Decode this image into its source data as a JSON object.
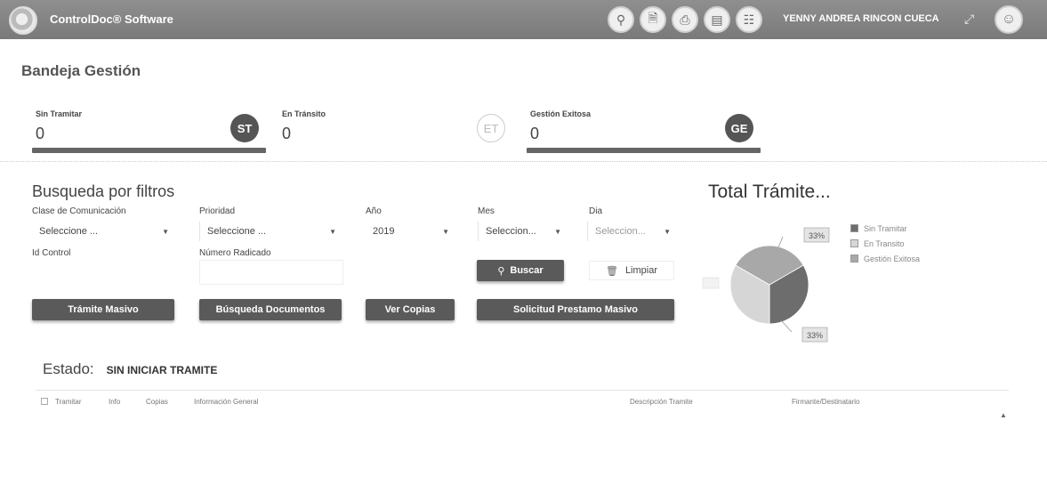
{
  "header": {
    "app_title": "ControlDoc® Software",
    "user_name": "YENNY ANDREA RINCON CUECA",
    "icons": [
      "search-icon",
      "document-icon",
      "print-icon",
      "file-icon",
      "report-icon"
    ]
  },
  "page_title": "Bandeja Gestión",
  "status_cards": [
    {
      "label": "Sin Tramitar",
      "value": "0",
      "badge": "ST"
    },
    {
      "label": "En Tránsito",
      "value": "0",
      "badge": "ET"
    },
    {
      "label": "Gestión Exitosa",
      "value": "0",
      "badge": "GE"
    }
  ],
  "filters": {
    "title": "Busqueda por filtros",
    "clase_label": "Clase de Comunicación",
    "clase_value": "Seleccione ...",
    "prioridad_label": "Prioridad",
    "prioridad_value": "Seleccione ...",
    "anio_label": "Año",
    "anio_value": "2019",
    "mes_label": "Mes",
    "mes_value": "Seleccion...",
    "dia_label": "Dia",
    "dia_value": "Seleccion...",
    "id_control_label": "Id Control",
    "numero_radicado_label": "Número Radicado",
    "buscar_label": "Buscar",
    "limpiar_label": "Limpiar"
  },
  "actions": {
    "tramite_masivo": "Trámite Masivo",
    "busqueda_documentos": "Búsqueda Documentos",
    "ver_copias": "Ver Copias",
    "solicitud_prestamo": "Solicitud Prestamo Masivo"
  },
  "chart_data": {
    "type": "pie",
    "title": "Total Trámite...",
    "categories": [
      "Sin Tramitar",
      "En Transito",
      "Gestión Exitosa"
    ],
    "values": [
      33,
      33,
      33
    ],
    "data_labels": [
      "33%",
      "33%"
    ],
    "colors": [
      "#6d6d6d",
      "#d6d6d6",
      "#a8a8a8"
    ],
    "legend_position": "right"
  },
  "estado": {
    "label": "Estado:",
    "value": "SIN INICIAR TRAMITE"
  },
  "table": {
    "columns": [
      "Tramitar",
      "Info",
      "Copias",
      "Información General",
      "Descripción Tramite",
      "Firmante/Destinatario"
    ]
  }
}
